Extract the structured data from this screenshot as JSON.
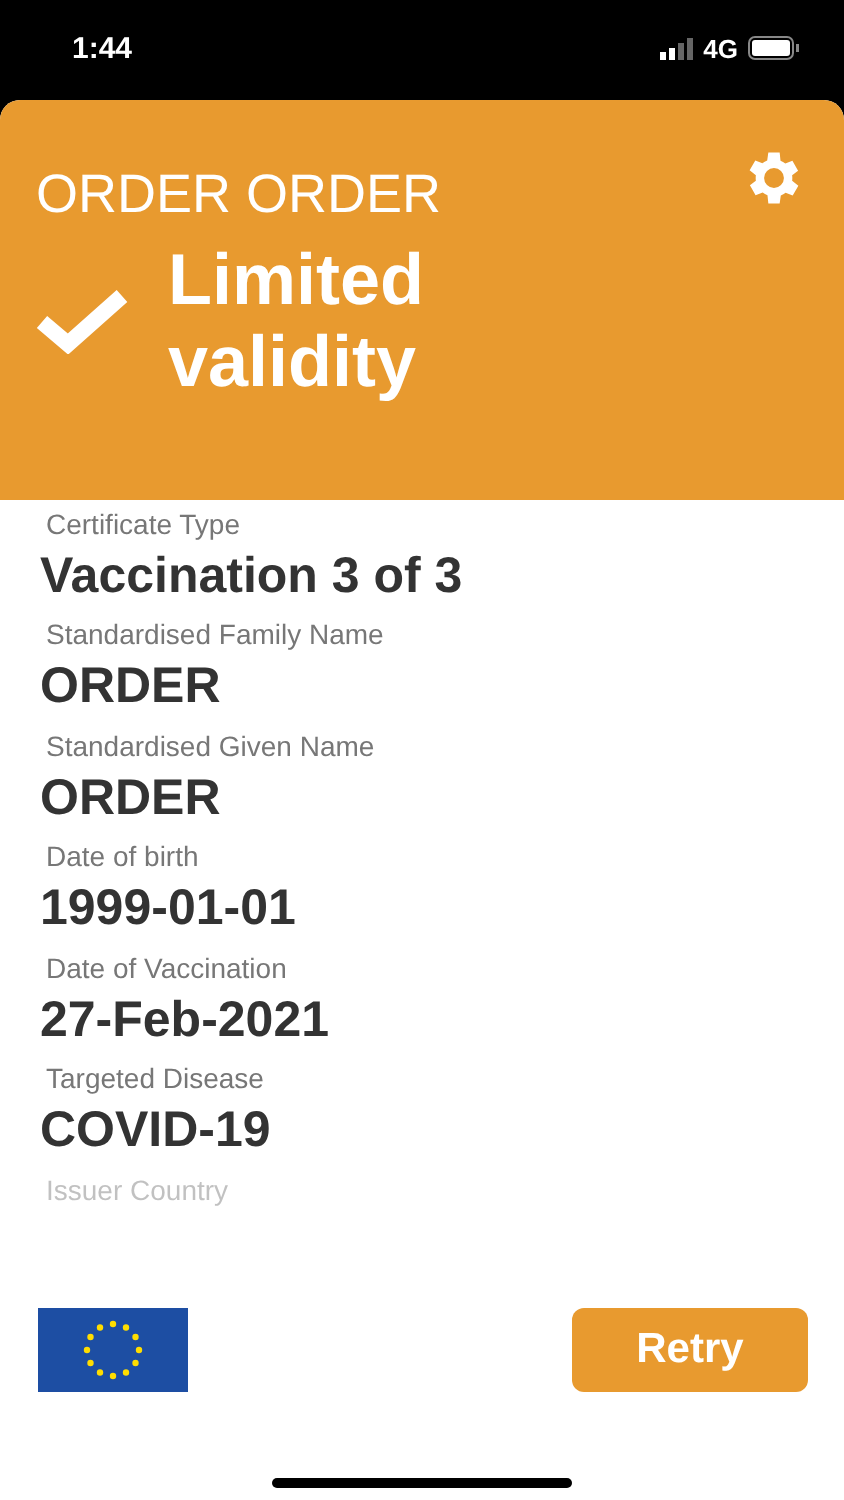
{
  "status_bar": {
    "time": "1:44",
    "network": "4G"
  },
  "header": {
    "name": "ORDER ORDER",
    "status": "Limited validity"
  },
  "fields": [
    {
      "label": "Certificate Type",
      "value": "Vaccination 3 of 3"
    },
    {
      "label": "Standardised Family Name",
      "value": "ORDER"
    },
    {
      "label": "Standardised Given Name",
      "value": "ORDER"
    },
    {
      "label": "Date of birth",
      "value": "1999-01-01"
    },
    {
      "label": "Date of Vaccination",
      "value": "27-Feb-2021"
    },
    {
      "label": "Targeted Disease",
      "value": "COVID-19"
    },
    {
      "label": "Issuer Country"
    }
  ],
  "footer": {
    "button": "Retry"
  }
}
